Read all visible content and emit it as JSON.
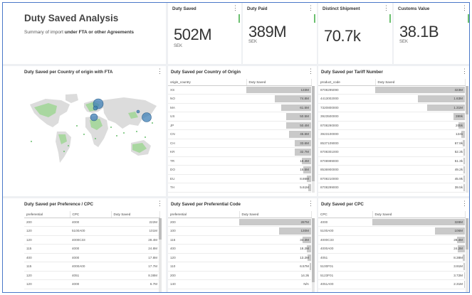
{
  "header": {
    "title": "Duty Saved Analysis",
    "subtitle_pre": "Summary of import ",
    "subtitle_bold": "under FTA or other Agreements"
  },
  "kpis": [
    {
      "title": "Duty Saved",
      "value": "502M",
      "unit": "SEK"
    },
    {
      "title": "Duty Paid",
      "value": "389M",
      "unit": "SEK"
    },
    {
      "title": "Distinct Shipment",
      "value": "70.7k",
      "unit": ""
    },
    {
      "title": "Customs Value",
      "value": "38.1B",
      "unit": "SEK"
    }
  ],
  "map": {
    "title": "Duty Saved per Country of origin with FTA"
  },
  "country_table": {
    "title": "Duty Saved per Country of Origin",
    "headers": [
      "origin_country",
      "Duty Saved"
    ],
    "rows": [
      {
        "c1": "XS",
        "v": "133M",
        "f": 1.0
      },
      {
        "c1": "NO",
        "v": "74.8M",
        "f": 0.56
      },
      {
        "c1": "MA",
        "v": "61.5M",
        "f": 0.46
      },
      {
        "c1": "US",
        "v": "50.5M",
        "f": 0.38
      },
      {
        "c1": "JP",
        "v": "50.4M",
        "f": 0.38
      },
      {
        "c1": "CN",
        "v": "45.6M",
        "f": 0.34
      },
      {
        "c1": "CH",
        "v": "33.6M",
        "f": 0.25
      },
      {
        "c1": "KR",
        "v": "32.7M",
        "f": 0.25
      },
      {
        "c1": "TR",
        "v": "18.4M",
        "f": 0.14
      },
      {
        "c1": "DO",
        "v": "15.5M",
        "f": 0.12
      },
      {
        "c1": "EU",
        "v": "8.86M",
        "f": 0.07
      },
      {
        "c1": "TH",
        "v": "5.61M",
        "f": 0.04
      }
    ]
  },
  "tariff_table": {
    "title": "Duty Saved per Tariff Number",
    "headers": [
      "product_code",
      "Duty Saved"
    ],
    "rows": [
      {
        "c1": "8708295090",
        "v": "323M",
        "f": 1.0
      },
      {
        "c1": "4413002000",
        "v": "1.63M",
        "f": 0.52
      },
      {
        "c1": "7320800000",
        "v": "1.31M",
        "f": 0.42
      },
      {
        "c1": "3923500000",
        "v": "399k",
        "f": 0.13
      },
      {
        "c1": "8708290000",
        "v": "205k",
        "f": 0.07
      },
      {
        "c1": "3923100000",
        "v": "124k",
        "f": 0.04
      },
      {
        "c1": "8537109000",
        "v": "67.9k",
        "f": 0.022
      },
      {
        "c1": "8708301000",
        "v": "52.3k",
        "f": 0.017
      },
      {
        "c1": "8708999000",
        "v": "51.3k",
        "f": 0.016
      },
      {
        "c1": "8536900000",
        "v": "49.2k",
        "f": 0.016
      },
      {
        "c1": "8708210000",
        "v": "45.9k",
        "f": 0.015
      },
      {
        "c1": "8708299000",
        "v": "39.5k",
        "f": 0.013
      }
    ]
  },
  "pref_cpc_table": {
    "title": "Duty Saved per Preference / CPC",
    "headers": [
      "preferential",
      "CPC",
      "Duty Saved"
    ],
    "rows": [
      [
        "200",
        "4000",
        "222M"
      ],
      [
        "120",
        "5100A00",
        "101M"
      ],
      [
        "120",
        "4000C33",
        "28.4M"
      ],
      [
        "115",
        "4000",
        "24.8M"
      ],
      [
        "400",
        "4000",
        "17.8M"
      ],
      [
        "115",
        "4000A00",
        "17.7M"
      ],
      [
        "120",
        "4051",
        "8.38M"
      ],
      [
        "120",
        "4000",
        "6.7M"
      ],
      [
        "120",
        "5100F01",
        ""
      ]
    ]
  },
  "pref_code_table": {
    "title": "Duty Saved per Preferential Code",
    "headers": [
      "preferential",
      "Duty Saved"
    ],
    "rows": [
      {
        "c1": "200",
        "v": "287M",
        "f": 1.0
      },
      {
        "c1": "100",
        "v": "130M",
        "f": 0.45
      },
      {
        "c1": "115",
        "v": "33.3M",
        "f": 0.12
      },
      {
        "c1": "400",
        "v": "18.2M",
        "f": 0.063
      },
      {
        "c1": "120",
        "v": "13.2M",
        "f": 0.046
      },
      {
        "c1": "110",
        "v": "6.57M",
        "f": 0.023
      },
      {
        "c1": "200",
        "v": "14.3k",
        "f": 0.0
      },
      {
        "c1": "140",
        "v": "N/A",
        "f": 0.0
      }
    ]
  },
  "cpc_table": {
    "title": "Duty Saved per CPC",
    "headers": [
      "CPC",
      "Duty Saved"
    ],
    "rows": [
      {
        "c1": "4000",
        "v": "328M",
        "f": 1.0
      },
      {
        "c1": "5100A00",
        "v": "106M",
        "f": 0.32
      },
      {
        "c1": "4000C33",
        "v": "28.4M",
        "f": 0.087
      },
      {
        "c1": "4000A00",
        "v": "24.2M",
        "f": 0.074
      },
      {
        "c1": "4051",
        "v": "8.38M",
        "f": 0.026
      },
      {
        "c1": "5100F01",
        "v": "3.91M",
        "f": 0.012
      },
      {
        "c1": "5123F01",
        "v": "3.72M",
        "f": 0.011
      },
      {
        "c1": "4051A00",
        "v": "2.31M",
        "f": 0.007
      },
      {
        "c1": "4000F01",
        "v": "",
        "f": 0.0
      }
    ]
  },
  "colors": {
    "accent_bar": "#6cc070",
    "bubble": "#3d7fb5",
    "map_fta": "#a9d7a0",
    "map_base": "#dcdcdc",
    "table_bar": "#c9c9c9"
  },
  "icons": {
    "panel_menu": "vertical-ellipsis-icon"
  }
}
